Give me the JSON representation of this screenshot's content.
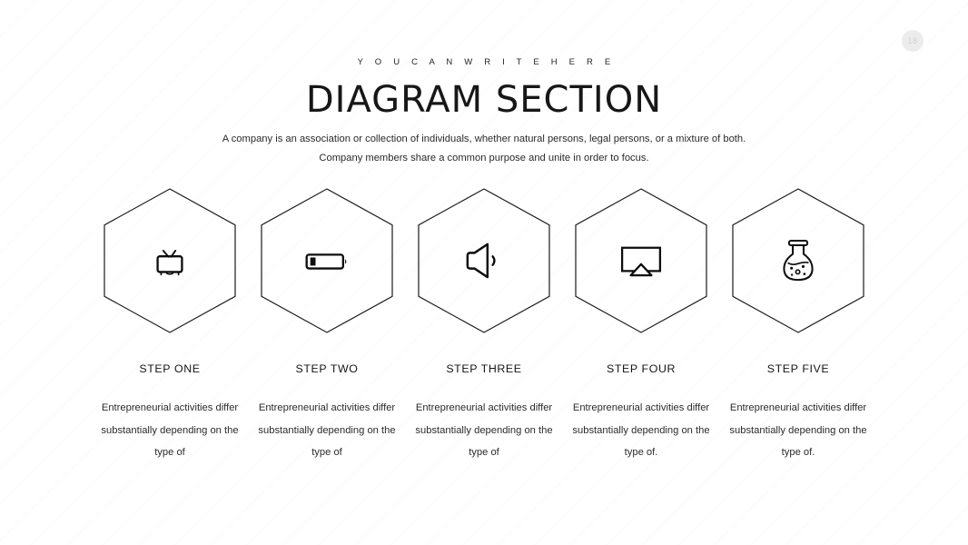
{
  "badge": {
    "number": "18"
  },
  "header": {
    "eyebrow": "Y O U   C A N   W R I T E   H E R E",
    "title": "DIAGRAM SECTION",
    "subtitle_line1": "A company is an association or collection of individuals, whether natural persons, legal persons, or a mixture of both.",
    "subtitle_line2": "Company members share a common purpose and unite in order to focus."
  },
  "colors": {
    "hex_outline": "#1a1a1a",
    "icon": "#0d0d0d",
    "text": "#1a1a1a",
    "badge_bg": "#ececec",
    "background": "#ffffff"
  },
  "steps": [
    {
      "icon_name": "television-icon",
      "title": "STEP ONE",
      "body": "Entrepreneurial activities differ substantially depending on the type of"
    },
    {
      "icon_name": "battery-low-icon",
      "title": "STEP TWO",
      "body": "Entrepreneurial activities differ substantially depending on the type of"
    },
    {
      "icon_name": "speaker-volume-icon",
      "title": "STEP THREE",
      "body": "Entrepreneurial activities differ substantially depending on the type of"
    },
    {
      "icon_name": "airplay-screen-icon",
      "title": "STEP FOUR",
      "body": "Entrepreneurial activities differ substantially depending on the type of."
    },
    {
      "icon_name": "lab-flask-icon",
      "title": "STEP FIVE",
      "body": "Entrepreneurial activities differ substantially depending on the type of."
    }
  ]
}
